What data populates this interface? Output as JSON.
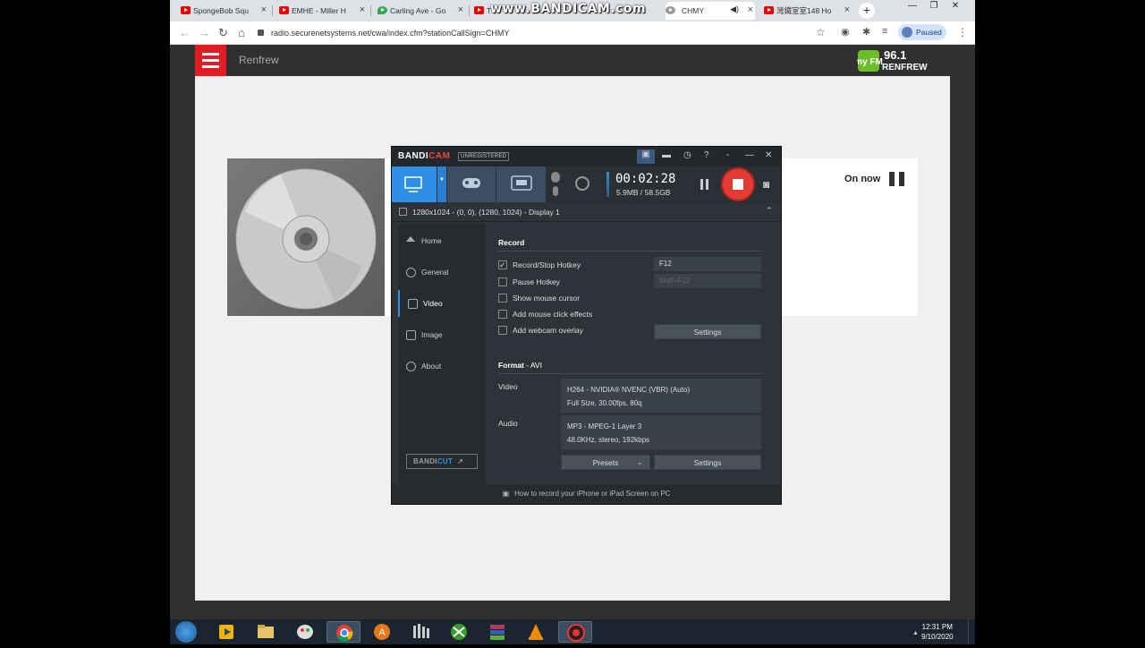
{
  "browser": {
    "tabs": [
      {
        "label": "SpongeBob Squ"
      },
      {
        "label": "EMHE - Miller H"
      },
      {
        "label": "Carling Ave - Go"
      },
      {
        "label": "T"
      },
      {
        "label": "CHMY"
      },
      {
        "label": "灣鐵室室148 Ho"
      }
    ],
    "watermark": "www.BANDICAM.com",
    "url": "radio.securenetsystems.net/cwa/index.cfm?stationCallSign=CHMY",
    "profile_label": "Paused"
  },
  "site": {
    "station_name": "Renfrew",
    "logo_text": "96.1",
    "logo_sub": "RENFREW",
    "logo_brand": "my FM",
    "on_now_label": "On now"
  },
  "bandicam": {
    "title_a": "BANDI",
    "title_b": "CAM",
    "unregistered": "UNREGISTERED",
    "timer": "00:02:28",
    "size_info": "5.9MB / 58.5GB",
    "target": "1280x1024 - (0, 0), (1280, 1024) - Display 1",
    "nav": [
      {
        "label": "Home"
      },
      {
        "label": "General"
      },
      {
        "label": "Video"
      },
      {
        "label": "Image"
      },
      {
        "label": "About"
      }
    ],
    "bandicut_a": "BANDI",
    "bandicut_b": "CUT",
    "record_section": "Record",
    "options": [
      {
        "label": "Record/Stop Hotkey",
        "checked": true
      },
      {
        "label": "Pause Hotkey",
        "checked": false
      },
      {
        "label": "Show mouse cursor",
        "checked": false
      },
      {
        "label": "Add mouse click effects",
        "checked": false
      },
      {
        "label": "Add webcam overlay",
        "checked": false
      }
    ],
    "hotkey_record": "F12",
    "hotkey_pause": "Shift+F12",
    "settings_label": "Settings",
    "format_section": "Format",
    "format_value": " - AVI",
    "video_label": "Video",
    "video_line1": "H264 - NVIDIA® NVENC (VBR) (Auto)",
    "video_line2": "Full Size, 30.00fps, 80q",
    "audio_label": "Audio",
    "audio_line1": "MP3 - MPEG-1 Layer 3",
    "audio_line2": "48.0KHz, stereo, 192kbps",
    "presets_label": "Presets",
    "footer": "How to record your iPhone or iPad Screen on PC"
  },
  "taskbar": {
    "time": "12:31 PM",
    "date": "9/10/2020"
  }
}
